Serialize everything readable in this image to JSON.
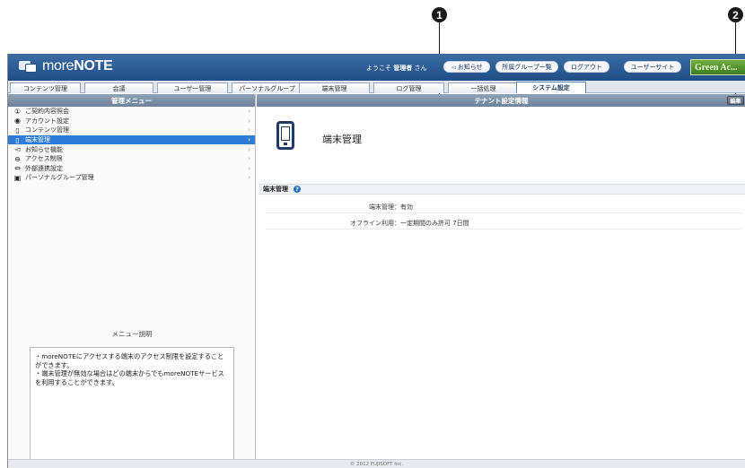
{
  "callouts": [
    "1",
    "2"
  ],
  "header": {
    "logo_more": "more",
    "logo_note": "NOTE",
    "welcome_prefix": "ようこそ",
    "welcome_user": "管理者",
    "welcome_suffix": "さん",
    "buttons": [
      "お知らせ",
      "所属グループ一覧",
      "ログアウト",
      "ユーザーサイト"
    ],
    "partner_logo": "Green Ac..."
  },
  "tabs": [
    "コンテンツ管理",
    "会議",
    "ユーザー管理",
    "パーソナルグループ",
    "端末管理",
    "ログ管理",
    "一括処理",
    "システム設定"
  ],
  "active_tab": "システム設定",
  "sidebar": {
    "title": "管理メニュー",
    "items": [
      {
        "label": "ご契約内容照会",
        "icon": "info-circle-icon",
        "glyph": "①"
      },
      {
        "label": "アカウント設定",
        "icon": "account-icon",
        "glyph": "◉"
      },
      {
        "label": "コンテンツ管理",
        "icon": "document-icon",
        "glyph": "▯"
      },
      {
        "label": "端末管理",
        "icon": "device-icon",
        "glyph": "▯"
      },
      {
        "label": "お知らせ機能",
        "icon": "megaphone-icon",
        "glyph": "◅"
      },
      {
        "label": "アクセス制限",
        "icon": "no-entry-icon",
        "glyph": "⊖"
      },
      {
        "label": "外部連携設定",
        "icon": "link-icon",
        "glyph": "⇔"
      },
      {
        "label": "パーソナルグループ管理",
        "icon": "group-icon",
        "glyph": "▣"
      }
    ],
    "active_index": 3,
    "desc_title": "メニュー説明",
    "desc_lines": [
      "・moreNOTEにアクセスする端末のアクセス制限を設定することができます。",
      "・端末管理が無効な場合はどの端末からでもmoreNOTEサービスを利用することができます。"
    ]
  },
  "main": {
    "title": "テナント設定情報",
    "edit_label": "編集",
    "device_title": "端末管理",
    "section_label": "端末管理",
    "rows": [
      {
        "label": "端末管理：",
        "value": "有効"
      },
      {
        "label": "オフライン利用：",
        "value": "一定期間のみ許可 7日間"
      }
    ]
  },
  "footer": "© 2012 FUJISOFT Inc."
}
